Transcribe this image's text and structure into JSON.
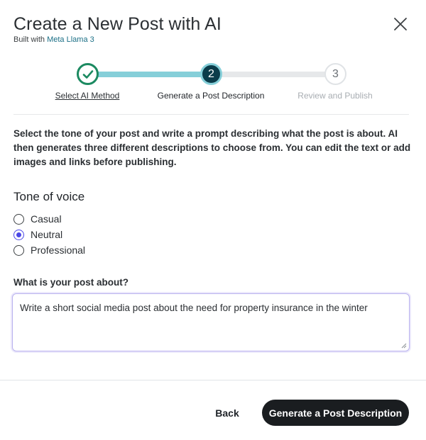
{
  "dialog": {
    "title": "Create a New Post with AI",
    "subtitle_prefix": "Built with",
    "subtitle_brand": "Meta Llama 3"
  },
  "stepper": {
    "steps": [
      {
        "number": "1",
        "label": "Select AI Method",
        "state": "completed"
      },
      {
        "number": "2",
        "label": "Generate a Post Description",
        "state": "active"
      },
      {
        "number": "3",
        "label": "Review and Publish",
        "state": "upcoming"
      }
    ]
  },
  "instructions": "Select the tone of your post and write a prompt describing what the post is about. AI then generates three different descriptions to choose from. You can edit the text or add images and links before publishing.",
  "tone": {
    "title": "Tone of voice",
    "options": [
      {
        "label": "Casual",
        "selected": false
      },
      {
        "label": "Neutral",
        "selected": true
      },
      {
        "label": "Professional",
        "selected": false
      }
    ]
  },
  "prompt": {
    "label": "What is your post about?",
    "value": "Write a short social media post about the need for property insurance in the winter"
  },
  "footer": {
    "back_label": "Back",
    "primary_label": "Generate a Post Description"
  },
  "colors": {
    "accent_teal": "#86cfd9",
    "step_complete": "#1c8a61",
    "step_active": "#0b3c4a",
    "radio_selected": "#4b47e6",
    "primary_button": "#1a1d20"
  }
}
